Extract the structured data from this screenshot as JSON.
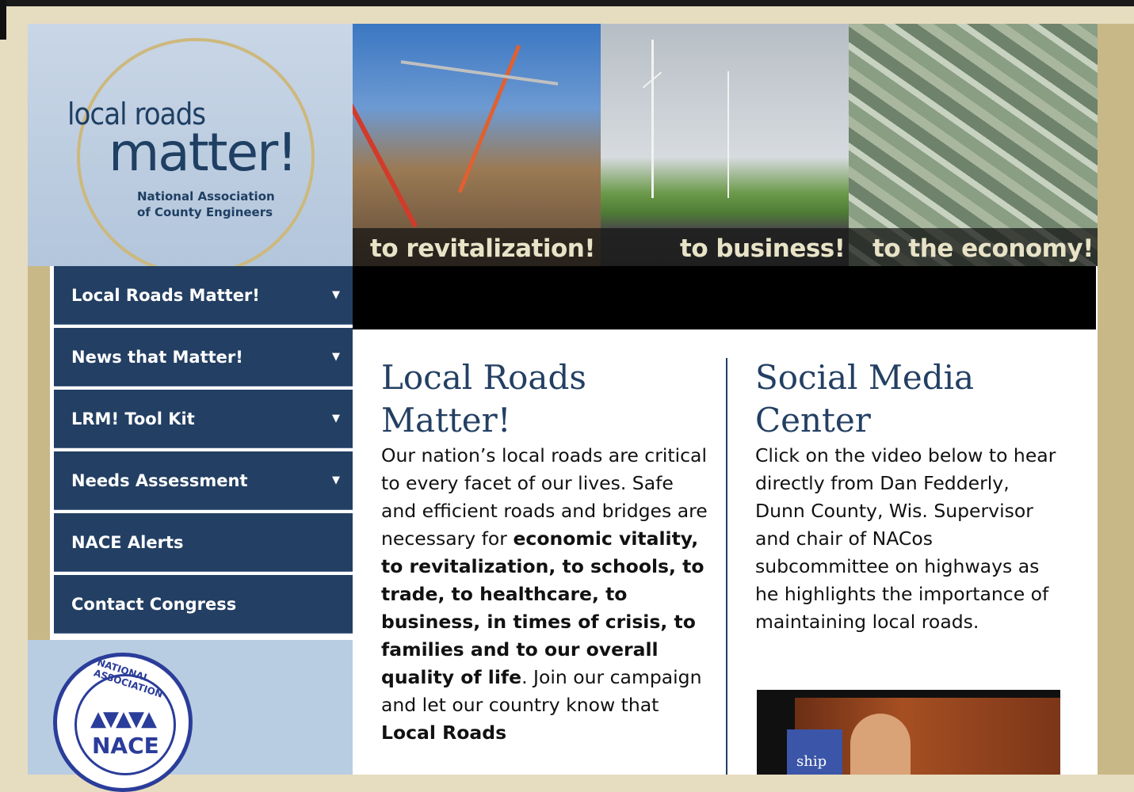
{
  "logo": {
    "line1": "local roads",
    "line2": "matter!",
    "line3a": "National Association",
    "line3b": "of County Engineers"
  },
  "banner": {
    "captions": [
      "to revitalization!",
      "to business!",
      "to the economy!"
    ]
  },
  "nav": {
    "items": [
      {
        "label": "Local Roads Matter!",
        "arrow": "▼"
      },
      {
        "label": "News that Matter!",
        "arrow": "▼"
      },
      {
        "label": "LRM! Tool Kit",
        "arrow": "▼"
      },
      {
        "label": "Needs Assessment",
        "arrow": "▼"
      },
      {
        "label": "NACE Alerts",
        "arrow": ""
      },
      {
        "label": "Contact Congress",
        "arrow": ""
      }
    ]
  },
  "seal": {
    "name": "NACE",
    "arc_text": "NATIONAL ASSOCIATION"
  },
  "main": {
    "title": "Local Roads Matter!",
    "intro": "Our nation’s local roads are critical to every facet of our lives. Safe and efficient roads and bridges are necessary for ",
    "bold": "economic vitality, to revitalization, to schools, to trade, to healthcare, to business, in times of crisis, to families and to our overall quality of life",
    "outro": ". Join our campaign and let our country know that ",
    "bold_end": "Local Roads"
  },
  "social": {
    "title": "Social Media Center",
    "body": "Click on the video below to hear directly from Dan Fedderly, Dunn County, Wis. Supervisor and chair of NACos subcommittee on highways as he highlights the importance of maintaining local roads.",
    "video_text": "ship"
  }
}
